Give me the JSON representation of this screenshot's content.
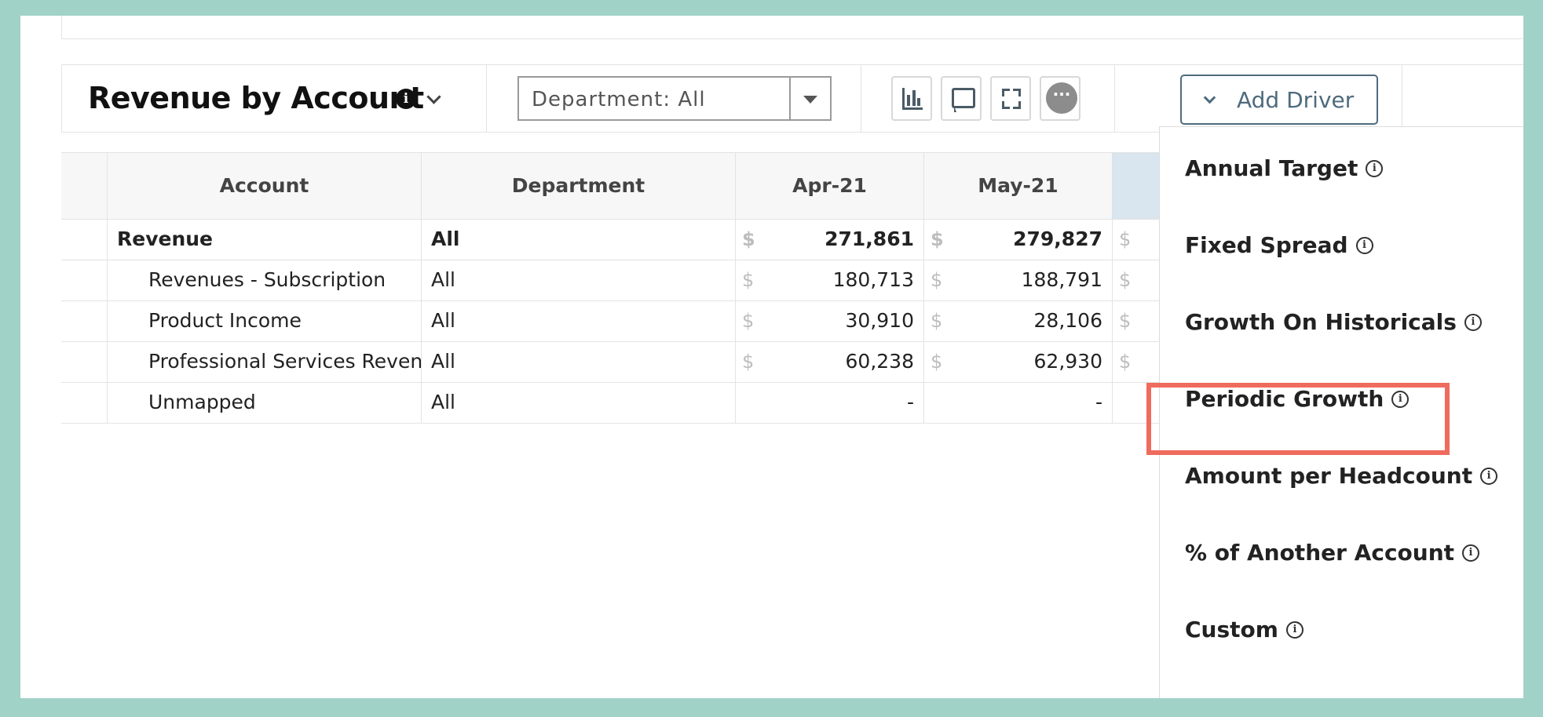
{
  "widget": {
    "title": "Revenue by Account",
    "info_icon": "info-icon",
    "expand_icon": "chevron-down-icon"
  },
  "filter": {
    "department_label": "Department: All"
  },
  "toolbar": {
    "chart_icon": "bar-chart-icon",
    "comment_icon": "comment-icon",
    "fullscreen_icon": "expand-icon",
    "more_icon": "more-icon",
    "more_glyph": "···",
    "add_driver_label": "Add Driver"
  },
  "table": {
    "headers": [
      "Account",
      "Department",
      "Apr-21",
      "May-21",
      ""
    ],
    "currency_symbol": "$",
    "rows": [
      {
        "account": "Revenue",
        "department": "All",
        "apr": "271,861",
        "may": "279,827",
        "bold": true
      },
      {
        "account": "Revenues - Subscription",
        "department": "All",
        "apr": "180,713",
        "may": "188,791"
      },
      {
        "account": "Product Income",
        "department": "All",
        "apr": "30,910",
        "may": "28,106"
      },
      {
        "account": "Professional Services Reven...",
        "department": "All",
        "apr": "60,238",
        "may": "62,930"
      },
      {
        "account": "Unmapped",
        "department": "All",
        "apr": "-",
        "may": "-"
      }
    ]
  },
  "driver_menu": {
    "items": [
      "Annual Target",
      "Fixed Spread",
      "Growth On Historicals",
      "Periodic Growth",
      "Amount per Headcount",
      "% of Another Account",
      "Custom"
    ],
    "highlighted": "Periodic Growth",
    "highlight_color": "#ef6b5e"
  }
}
